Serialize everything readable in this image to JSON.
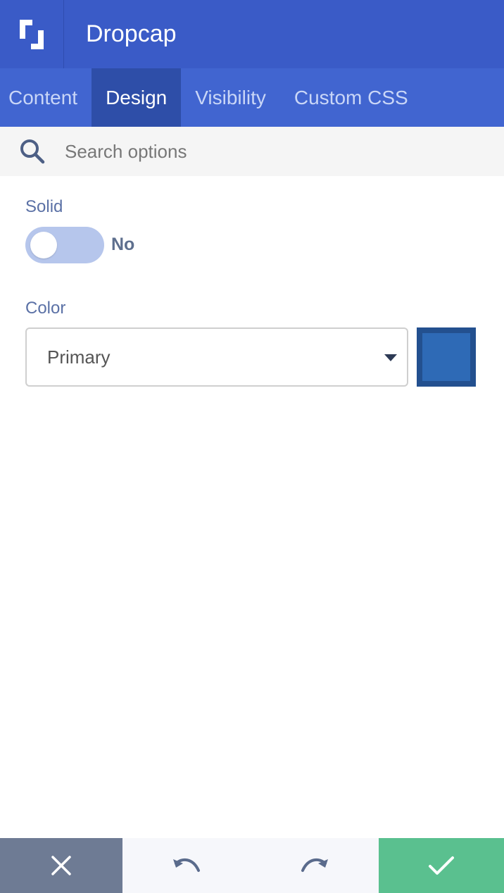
{
  "header": {
    "title": "Dropcap",
    "logo_icon": "bracket-logo-icon"
  },
  "tabs": [
    {
      "label": "Content",
      "active": false
    },
    {
      "label": "Design",
      "active": true
    },
    {
      "label": "Visibility",
      "active": false
    },
    {
      "label": "Custom CSS",
      "active": false
    }
  ],
  "search": {
    "placeholder": "Search options",
    "value": "",
    "icon": "search-icon"
  },
  "fields": {
    "solid": {
      "label": "Solid",
      "state_text": "No",
      "checked": false
    },
    "color": {
      "label": "Color",
      "selected": "Primary",
      "swatch_color": "#2e6ab6"
    }
  },
  "footer": {
    "cancel_icon": "close-icon",
    "undo_icon": "undo-icon",
    "redo_icon": "redo-icon",
    "save_icon": "check-icon"
  },
  "colors": {
    "header_bg": "#3a5bc7",
    "tabs_bg": "#4165d0",
    "active_tab_bg": "#2e4ea8",
    "cancel_bg": "#6e7b94",
    "save_bg": "#5ac08f"
  }
}
